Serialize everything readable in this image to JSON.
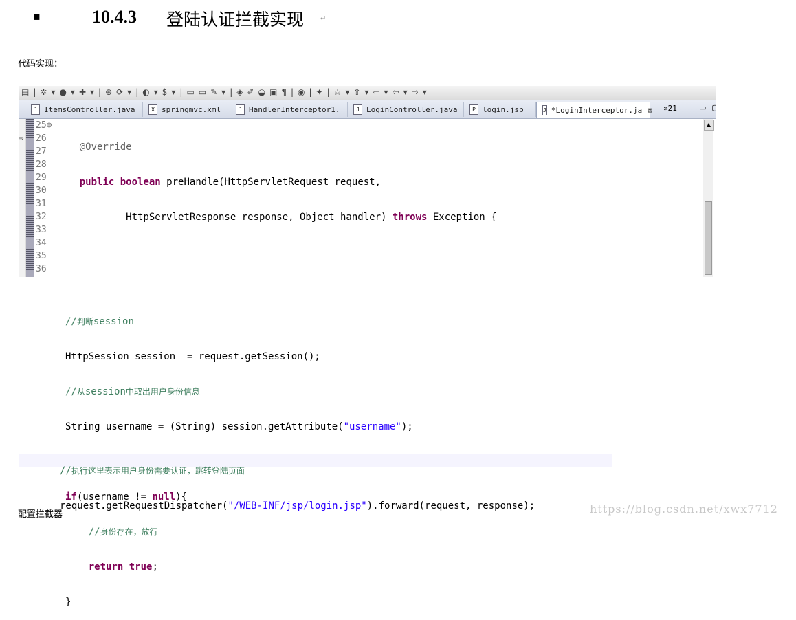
{
  "heading": {
    "bullet": "▪",
    "number": "10.4.3",
    "title": "登陆认证拦截实现",
    "return_mark": "↵"
  },
  "intro_label": "代码实现：",
  "config_label": "配置拦截器",
  "watermark": "https://blog.csdn.net/xwx7712",
  "ide": {
    "tabs": [
      {
        "label": "ItemsController.java",
        "icon": "J"
      },
      {
        "label": "springmvc.xml",
        "icon": "X"
      },
      {
        "label": "HandlerInterceptor1.",
        "icon": "J"
      },
      {
        "label": "LoginController.java",
        "icon": "J"
      },
      {
        "label": "login.jsp",
        "icon": "P"
      },
      {
        "label": "*LoginInterceptor.ja",
        "icon": "J",
        "active": true
      }
    ],
    "tab_overflow": "»21",
    "line_numbers": [
      "25⊖",
      "26",
      "27",
      "28",
      "29",
      "30",
      "31",
      "32",
      "33",
      "34",
      "35",
      "36"
    ]
  }
}
